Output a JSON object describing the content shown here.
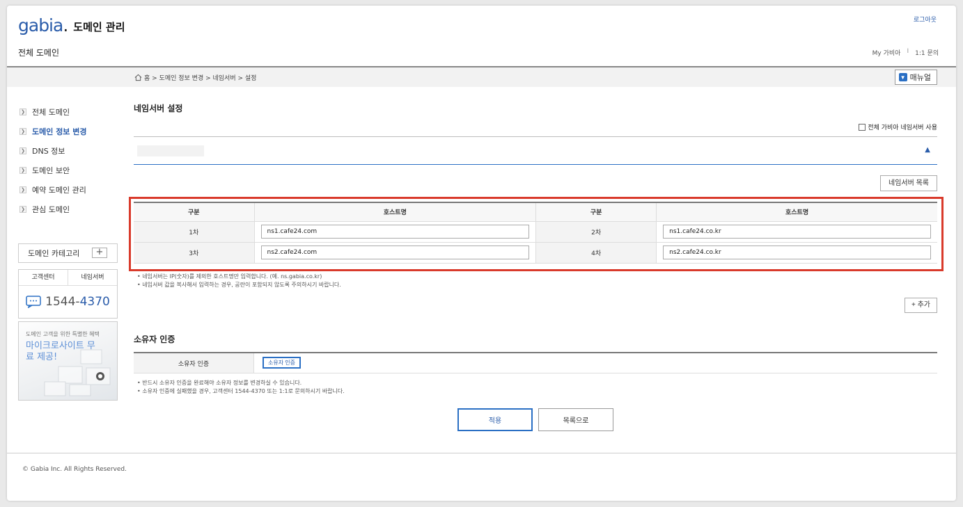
{
  "header": {
    "logo_mark": "gabia",
    "logo_dot": ".",
    "title": "도메인 관리",
    "logout": "로그아웃",
    "page_title": "전체 도메인",
    "util_links": [
      "My 가비아",
      "1:1 문의"
    ],
    "util_sep": "I"
  },
  "breadcrumb": {
    "text": "홈 > 도메인 정보 변경 > 네임서버 > 설정",
    "manual_button": "매뉴얼"
  },
  "sidebar": {
    "items": [
      {
        "label": "전체 도메인",
        "active": false
      },
      {
        "label": "도메인 정보 변경",
        "active": true
      },
      {
        "label": "DNS 정보",
        "active": false
      },
      {
        "label": "도메인 보안",
        "active": false
      },
      {
        "label": "예약 도메인 관리",
        "active": false
      },
      {
        "label": "관심 도메인",
        "active": false
      }
    ],
    "category_label": "도메인 카테고리",
    "category_add": "+",
    "cs_tabs": [
      "고객센터",
      "네임서버"
    ],
    "cs_phone_prefix": "1544-",
    "cs_phone_suffix": "4370",
    "promo_sub": "도메인 고객을 위한 특별한 혜택",
    "promo_title": "마이크로사이트 무료 제공!"
  },
  "nameserver": {
    "title": "네임서버 설정",
    "all_gabia_label": "전체 가비아 네임서버 사용",
    "collapse_icon": "▲",
    "list_button": "네임서버 목록",
    "columns": [
      "구분",
      "호스트명",
      "구분",
      "호스트명"
    ],
    "rows": [
      {
        "label_a": "1차",
        "host_a": "ns1.cafe24.com",
        "label_b": "2차",
        "host_b": "ns1.cafe24.co.kr"
      },
      {
        "label_a": "3차",
        "host_a": "ns2.cafe24.com",
        "label_b": "4차",
        "host_b": "ns2.cafe24.co.kr"
      }
    ],
    "notes": [
      "네임서버는 IP(숫자)를 제외한 호스트명만 입력합니다. (예. ns.gabia.co.kr)",
      "네임서버 값을 복사해서 입력하는 경우, 공란이 포함되지 않도록 주의하시기 바랍니다."
    ],
    "add_button": "+ 추가"
  },
  "owner": {
    "title": "소유자 인증",
    "label": "소유자 인증",
    "button": "소유자 인증",
    "notes": [
      "반드시 소유자 인증을 완료해야 소유자 정보를 변경하실 수 있습니다.",
      "소유자 인증에 실패했을 경우, 고객센터 1544-4370 또는 1:1로 문의하시기 바랍니다."
    ]
  },
  "actions": {
    "apply": "적용",
    "list": "목록으로"
  },
  "footer": {
    "copyright": "© Gabia Inc. All Rights Reserved."
  },
  "colors": {
    "brand_blue": "#2a5caa",
    "highlight_red": "#d93a2b"
  }
}
